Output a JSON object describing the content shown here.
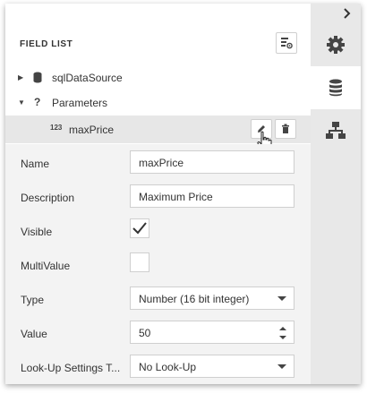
{
  "panel": {
    "title": "FIELD LIST"
  },
  "tree": {
    "items": [
      {
        "label": "sqlDataSource",
        "expanded": false,
        "icon": "database-icon"
      },
      {
        "label": "Parameters",
        "expanded": true,
        "icon": "question-mark-icon"
      },
      {
        "label": "maxPrice",
        "type_badge": "123",
        "selected": true,
        "icon": "numeric-type-icon"
      }
    ]
  },
  "properties": {
    "name": {
      "label": "Name",
      "value": "maxPrice"
    },
    "description": {
      "label": "Description",
      "value": "Maximum Price"
    },
    "visible": {
      "label": "Visible",
      "checked": true
    },
    "multivalue": {
      "label": "MultiValue",
      "checked": false
    },
    "type": {
      "label": "Type",
      "value": "Number (16 bit integer)"
    },
    "value": {
      "label": "Value",
      "value": "50"
    },
    "lookup": {
      "label": "Look-Up Settings T...",
      "value": "No Look-Up"
    }
  },
  "side_tabs": [
    {
      "icon": "gear-icon",
      "active": false
    },
    {
      "icon": "database-icon",
      "active": true
    },
    {
      "icon": "hierarchy-icon",
      "active": false
    }
  ],
  "colors": {
    "selected_row": "#e7e7e7",
    "properties_bg": "#f3f3f3",
    "sidebar_bg": "#e8e8e8",
    "icon": "#444444"
  }
}
